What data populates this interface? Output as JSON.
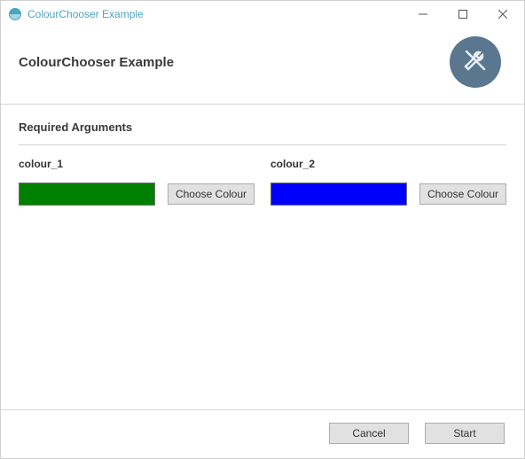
{
  "window": {
    "title": "ColourChooser Example"
  },
  "header": {
    "title": "ColourChooser Example"
  },
  "section": {
    "title": "Required Arguments"
  },
  "args": {
    "colour1": {
      "label": "colour_1",
      "value": "#008000",
      "button": "Choose Colour"
    },
    "colour2": {
      "label": "colour_2",
      "value": "#0000ff",
      "button": "Choose Colour"
    }
  },
  "footer": {
    "cancel": "Cancel",
    "start": "Start"
  }
}
